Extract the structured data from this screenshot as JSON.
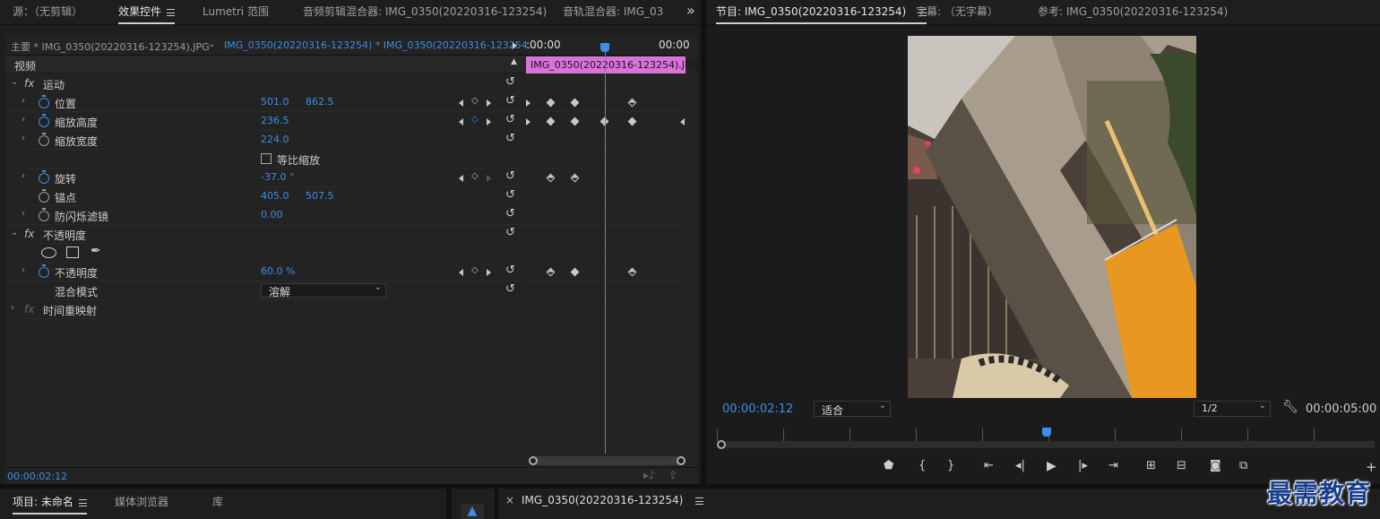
{
  "top_tabs": {
    "source": "源：（无剪辑）",
    "effect_controls": "效果控件",
    "lumetri": "Lumetri 范围",
    "audio_clip_mixer": "音频剪辑混合器: IMG_0350(20220316-123254)",
    "audio_track_mixer": "音轨混合器: IMG_03",
    "overflow": "»"
  },
  "ec_header": {
    "master": "主要 * IMG_0350(20220316-123254).JPG",
    "clip": "IMG_0350(20220316-123254) * IMG_0350(20220316-123254...",
    "ruler_start": ":00:00",
    "ruler_end": "00:00",
    "clip_bar": "IMG_0350(20220316-123254).JPG"
  },
  "sections": {
    "video": "视频",
    "motion": "运动",
    "opacity": "不透明度",
    "time_remap": "时间重映射"
  },
  "props": {
    "position": {
      "label": "位置",
      "v1": "501.0",
      "v2": "862.5"
    },
    "scale_h": {
      "label": "缩放高度",
      "v1": "236.5"
    },
    "scale_w": {
      "label": "缩放宽度",
      "v1": "224.0"
    },
    "uniform": {
      "label": "等比缩放"
    },
    "rotation": {
      "label": "旋转",
      "v1": "-37.0 °"
    },
    "anchor": {
      "label": "锚点",
      "v1": "405.0",
      "v2": "507.5"
    },
    "flicker": {
      "label": "防闪烁滤镜",
      "v1": "0.00"
    },
    "opacity": {
      "label": "不透明度",
      "v1": "60.0 %"
    },
    "blend": {
      "label": "混合模式",
      "v1": "溶解"
    }
  },
  "ec_footer": {
    "time": "00:00:02:12"
  },
  "program": {
    "tab_program": "节目: IMG_0350(20220316-123254)",
    "tab_captions": "字幕: （无字幕）",
    "tab_reference": "参考: IMG_0350(20220316-123254)",
    "timecode": "00:00:02:12",
    "fit": "适合",
    "resolution": "1/2",
    "duration": "00:00:05:00"
  },
  "bottom": {
    "project": "项目: 未命名",
    "media_browser": "媒体浏览器",
    "library": "库",
    "seq_tab": "IMG_0350(20220316-123254)",
    "watermark": "最需教育"
  },
  "colors": {
    "accent": "#3d8ee6",
    "clip": "#d874d8",
    "bg": "#1e1e1e"
  }
}
